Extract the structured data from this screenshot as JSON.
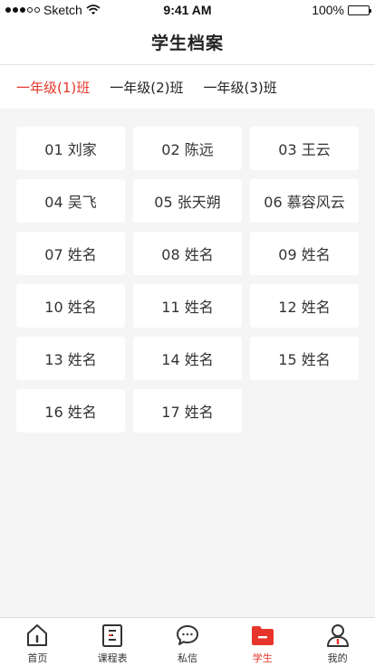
{
  "status_bar": {
    "carrier": "Sketch",
    "time": "9:41 AM",
    "battery": "100%",
    "battery_level": 1.0
  },
  "nav": {
    "title": "学生档案"
  },
  "class_tabs": [
    {
      "label": "一年级(1)班",
      "active": true
    },
    {
      "label": "一年级(2)班",
      "active": false
    },
    {
      "label": "一年级(3)班",
      "active": false
    }
  ],
  "students": [
    "01 刘家",
    "02 陈远",
    "03 王云",
    "04 吴飞",
    "05 张天朔",
    "06 慕容风云",
    "07 姓名",
    "08 姓名",
    "09 姓名",
    "10 姓名",
    "11 姓名",
    "12 姓名",
    "13 姓名",
    "14 姓名",
    "15 姓名",
    "16 姓名",
    "17 姓名"
  ],
  "tab_bar": [
    {
      "label": "首页",
      "icon": "home-icon",
      "active": false
    },
    {
      "label": "课程表",
      "icon": "schedule-icon",
      "active": false
    },
    {
      "label": "私信",
      "icon": "message-icon",
      "active": false
    },
    {
      "label": "学生",
      "icon": "student-folder-icon",
      "active": true
    },
    {
      "label": "我的",
      "icon": "profile-icon",
      "active": false
    }
  ],
  "colors": {
    "accent": "#e8352b",
    "background": "#f5f5f5",
    "text": "#333333"
  }
}
